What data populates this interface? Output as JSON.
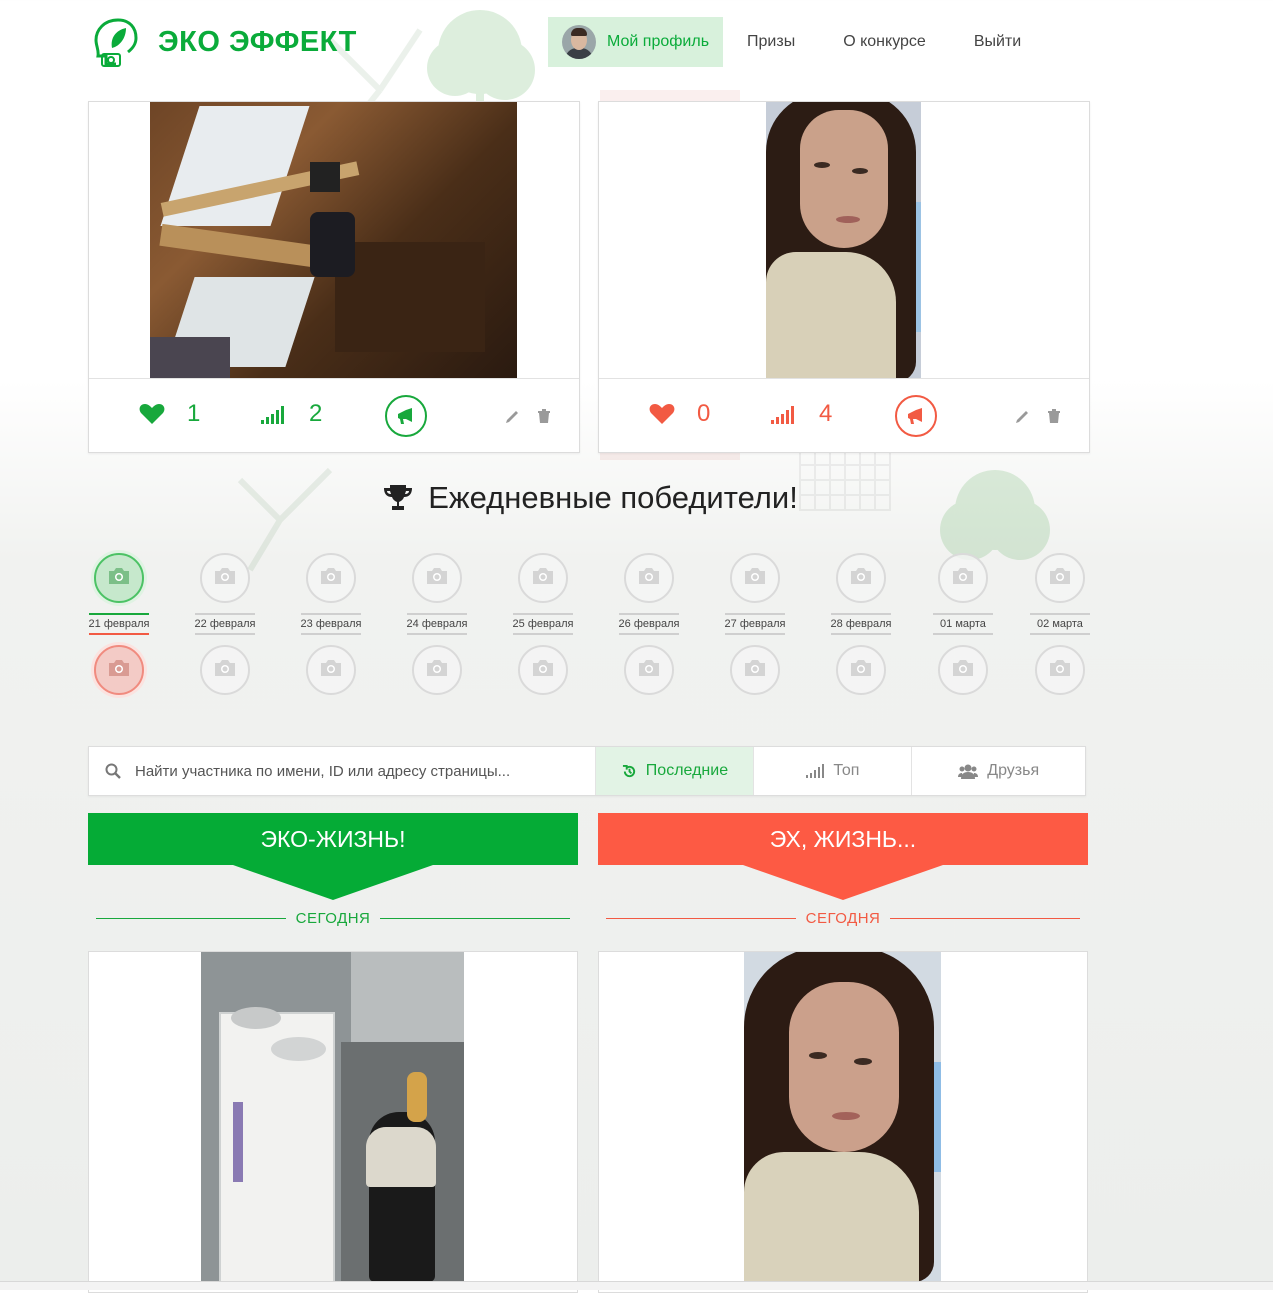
{
  "brand": {
    "name": "ЭКО ЭФФЕКТ",
    "color": "#0aab3a"
  },
  "nav": [
    {
      "label": "Мой профиль",
      "active": true
    },
    {
      "label": "Призы"
    },
    {
      "label": "О конкурсе"
    },
    {
      "label": "Выйти"
    }
  ],
  "my_photos": [
    {
      "likes": "1",
      "rating": "2",
      "side": "eco",
      "accent": "#18a83c"
    },
    {
      "likes": "0",
      "rating": "4",
      "side": "bad",
      "accent": "#f25a43"
    }
  ],
  "winners": {
    "title": "Ежедневные победители!",
    "dates": [
      "21 февраля",
      "22 февраля",
      "23 февраля",
      "24 февраля",
      "25 февраля",
      "26 февраля",
      "27 февраля",
      "28 февраля",
      "01 марта",
      "02 марта"
    ],
    "active_index": 0
  },
  "search": {
    "placeholder": "Найти участника по имени, ID или адресу страницы...",
    "value": ""
  },
  "tabs": [
    {
      "label": "Последние",
      "icon": "history-icon",
      "active": true
    },
    {
      "label": "Топ",
      "icon": "signal-icon"
    },
    {
      "label": "Друзья",
      "icon": "users-icon"
    }
  ],
  "columns": {
    "left": {
      "title": "ЭКО-ЖИЗНЬ!",
      "divider": "СЕГОДНЯ",
      "color": "#05ab36"
    },
    "right": {
      "title": "ЭХ, ЖИЗНЬ...",
      "divider": "СЕГОДНЯ",
      "color": "#fd5a44"
    }
  }
}
